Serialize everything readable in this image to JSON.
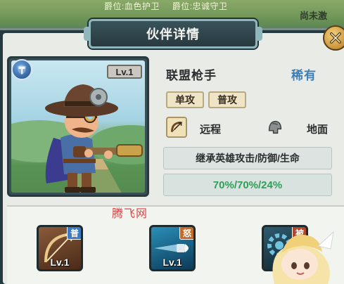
{
  "background": {
    "top_titles": [
      "爵位:血色护卫",
      "爵位:忠诚守卫"
    ],
    "right_text": "尚未激"
  },
  "header": {
    "title": "伙伴详情"
  },
  "close_button": {
    "icon": "close-icon"
  },
  "portrait": {
    "class_icon": "hammer-shield-icon",
    "level": "Lv.1"
  },
  "hero": {
    "name": "联盟枪手",
    "rarity": "稀有",
    "tags": [
      "单攻",
      "普攻"
    ],
    "range_icon": "bow-icon",
    "range_label": "远程",
    "terrain_icon": "helmet-icon",
    "terrain_label": "地面",
    "inherit_text": "继承英雄攻击/防御/生命",
    "inherit_ratio": "70%/70%/24%"
  },
  "watermark": "腾飞网",
  "skills": [
    {
      "type": "普",
      "type_color": "#3c7ac4",
      "level": "Lv.1",
      "icon": "crossbow-icon"
    },
    {
      "type": "怒",
      "type_color": "#c46b2b",
      "level": "Lv.1",
      "icon": "bullet-icon"
    },
    {
      "type": "被",
      "type_color": "#b0492b",
      "level": "",
      "icon": "gear-icon"
    }
  ],
  "colors": {
    "rarity": "#3d7fb4",
    "ratio": "#2f9e58",
    "panel": "#253a3e"
  }
}
